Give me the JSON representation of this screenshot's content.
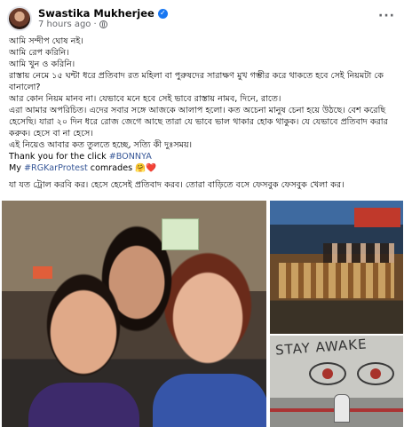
{
  "post": {
    "author": "Swastika Mukherjee",
    "time": "7 hours ago",
    "icons": {
      "verified": "verified-badge-icon",
      "privacy": "globe-icon",
      "more": "more-options-icon"
    },
    "more_label": "···",
    "lines": [
      "আমি সন্দীপ ঘোষ নই।",
      "আমি রেপ করিনি।",
      "আমি খুন ও করিনি।",
      "রাস্তায় নেমে ১৫ ঘন্টা ধরে প্রতিবাদ রত মহিলা বা পুরুষদের সারাক্ষণ মুখ গম্ভীর করে থাকতে হবে সেই নিয়মটা কে বানালো?",
      "আর কোন নিয়ম মানব না। যেভাবে মনে হবে সেই ভাবে রাস্তায় নামব, দিনে, রাতে।",
      "এরা আমার অপরিচিত। এদের সবার সঙ্গে আজকে আলাপ হলো। কত অচেনা মানুষ চেনা হয়ে উঠছে। বেশ করেছি হেসেছি। যারা ২০ দিন ধরে রোজ জেগে আছে তারা যে ভাবে ভাল থাকার হোক থাকুক। যে যেভাবে প্রতিবাদ করার করুক। হেসে বা না হেসে।",
      "এই নিয়েও আবার কত তুলতে হচ্ছে, সত্যি কী দুঃসময়।"
    ],
    "thanks_prefix": "Thank you for the click ",
    "thanks_tag": "#BONNYA",
    "my_prefix": "My ",
    "my_tag": "#RGKarProtest",
    "my_suffix": " comrades 🤗❤️",
    "closing": "যা যত ট্রোল করবি কর। হেসে হেসেই প্রতিবাদ করব। তোরা বাড়িতে বসে ফেসবুক ফেসবুক খেলা কর।",
    "photos": {
      "stay_awake": "STAY AWAKE"
    }
  }
}
